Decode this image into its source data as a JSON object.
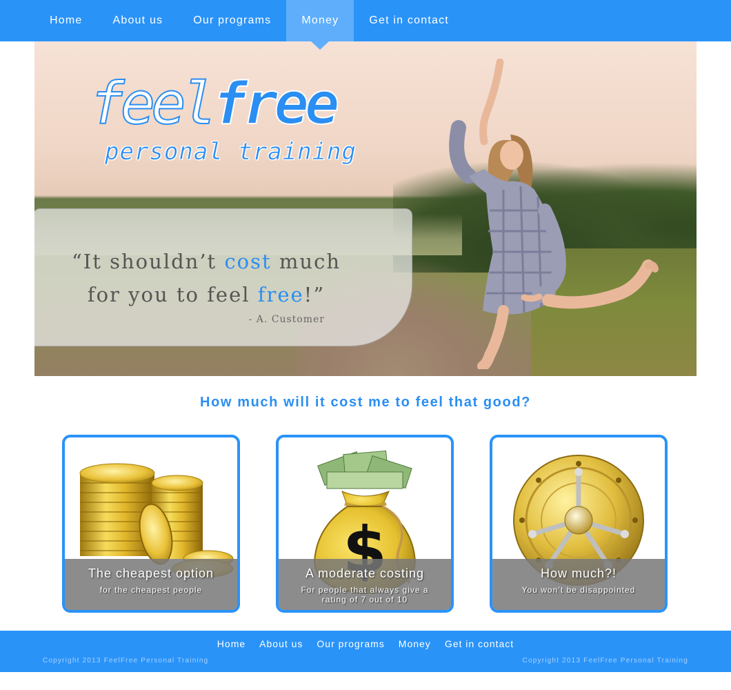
{
  "nav": {
    "items": [
      {
        "label": "Home"
      },
      {
        "label": "About us"
      },
      {
        "label": "Our programs"
      },
      {
        "label": "Money",
        "active": true
      },
      {
        "label": "Get in contact"
      }
    ]
  },
  "hero": {
    "logo_feel": "feel",
    "logo_free": "free",
    "logo_sub": "personal training",
    "quote_open": "“It shouldn’t ",
    "quote_hl1": "cost",
    "quote_mid": " much",
    "quote_line2": "for you to feel ",
    "quote_hl2": "free",
    "quote_close": "!”",
    "quote_author": "- A. Customer"
  },
  "headline": "How much will it cost me to feel that good?",
  "cards": [
    {
      "title": "The cheapest option",
      "subtitle": "for the cheapest people",
      "icon": "gold-coins-icon"
    },
    {
      "title": "A moderate costing",
      "subtitle": "For people that always give a rating of 7 out of 10",
      "icon": "money-bag-icon"
    },
    {
      "title": "How much?!",
      "subtitle": "You won’t be disappointed",
      "icon": "vault-icon"
    }
  ],
  "footer": {
    "items": [
      {
        "label": "Home"
      },
      {
        "label": "About us"
      },
      {
        "label": "Our programs"
      },
      {
        "label": "Money"
      },
      {
        "label": "Get in contact"
      }
    ],
    "copyright_left": "Copyright 2013 FeelFree Personal Training",
    "copyright_right": "Copyright 2013 FeelFree Personal Training"
  },
  "colors": {
    "brand_blue": "#2a93f8",
    "accent_blue": "#2a8ef2",
    "nav_active": "#5eaefb",
    "gold": "#e8c53a"
  }
}
